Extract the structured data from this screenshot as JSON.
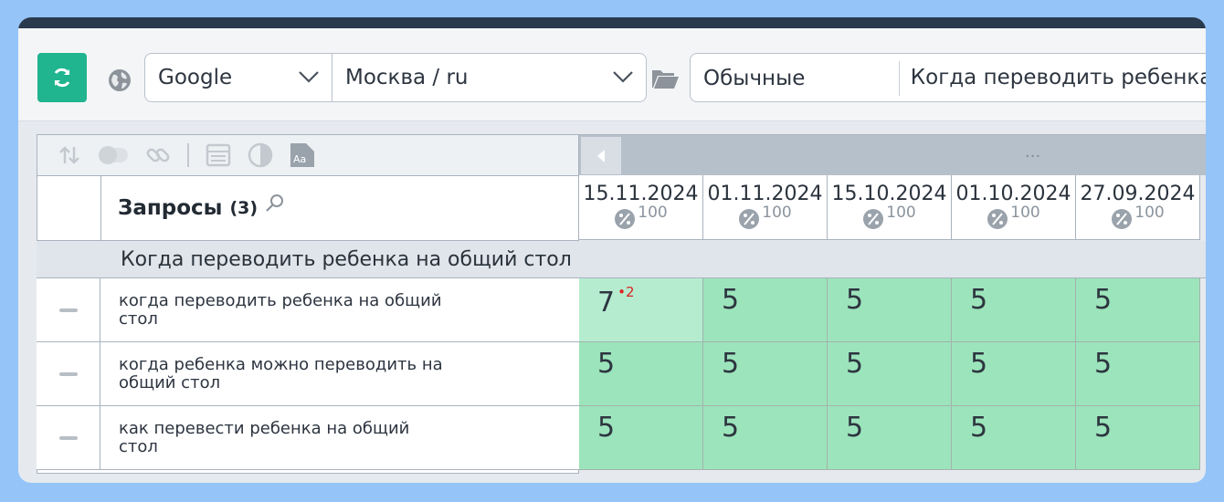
{
  "toolbar": {
    "engine": "Google",
    "region": "Москва / ru",
    "type": "Обычные",
    "group": "Когда переводить ребенка на общий стол"
  },
  "table": {
    "title": "Запросы",
    "count": "(3)",
    "group_name": "Когда переводить ребенка на общий стол",
    "dots": "...",
    "dates": [
      {
        "date": "15.11.2024",
        "pct": "100"
      },
      {
        "date": "01.11.2024",
        "pct": "100"
      },
      {
        "date": "15.10.2024",
        "pct": "100"
      },
      {
        "date": "01.10.2024",
        "pct": "100"
      },
      {
        "date": "27.09.2024",
        "pct": "100"
      }
    ],
    "rows": [
      {
        "query": "когда переводить ребенка на общий стол",
        "positions": [
          "7",
          "5",
          "5",
          "5",
          "5"
        ],
        "delta": "2"
      },
      {
        "query": "когда ребенка можно переводить на общий стол",
        "positions": [
          "5",
          "5",
          "5",
          "5",
          "5"
        ]
      },
      {
        "query": "как перевести ребенка на общий стол",
        "positions": [
          "5",
          "5",
          "5",
          "5",
          "5"
        ]
      }
    ]
  },
  "colors": {
    "accent": "#20b58f",
    "cell_green": "#9ce4bb",
    "cell_highlight": "#b5ecd0",
    "delta_red": "#dd2222"
  }
}
